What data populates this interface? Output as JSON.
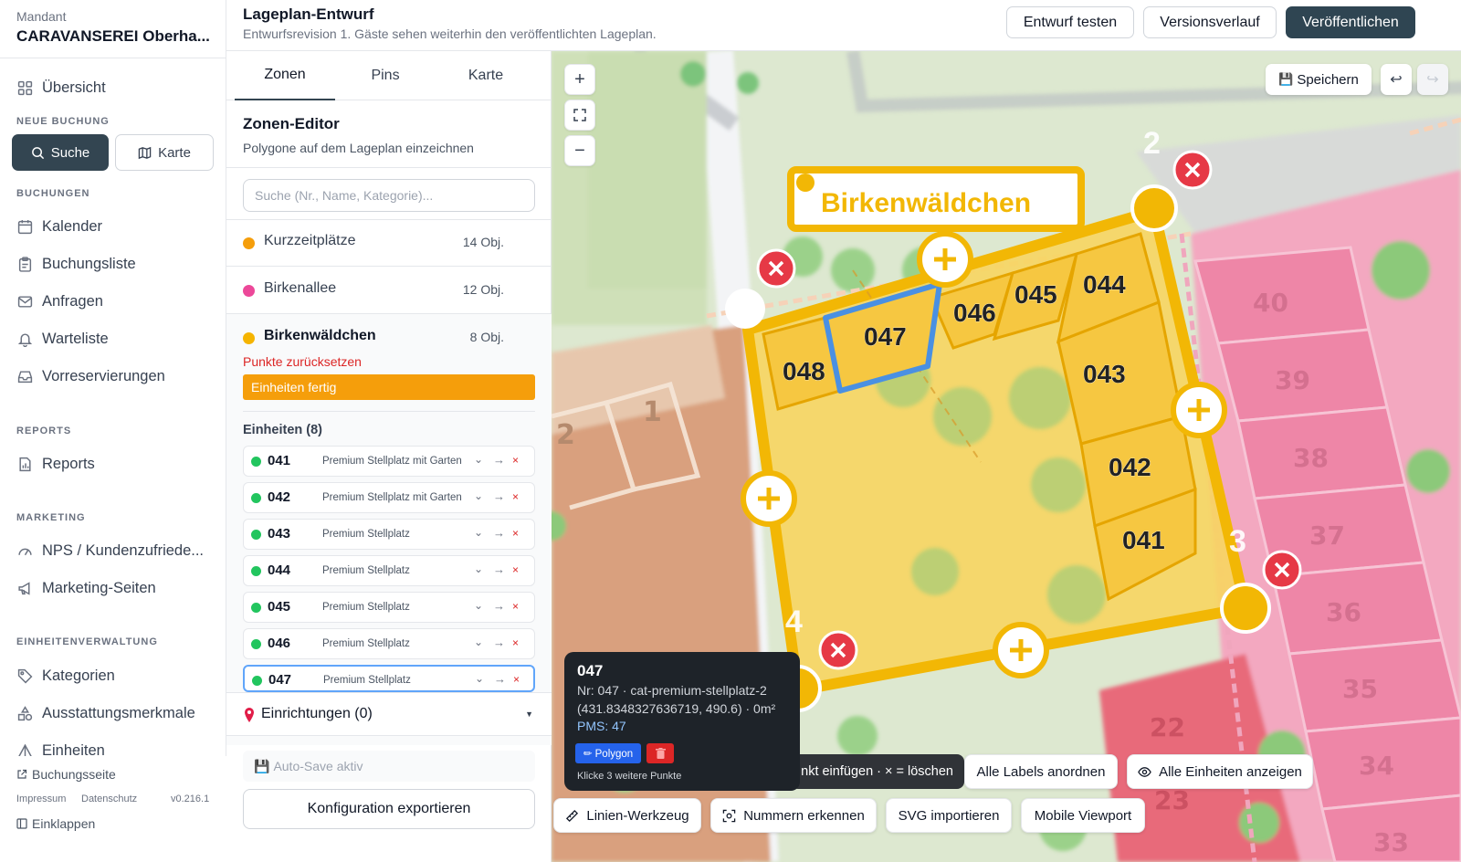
{
  "sidebar": {
    "tenant_label": "Mandant",
    "tenant_name": "CARAVANSEREI Oberha...",
    "overview": "Übersicht",
    "section_new_booking": "NEUE BUCHUNG",
    "btn_search": "Suche",
    "btn_map": "Karte",
    "section_bookings": "BUCHUNGEN",
    "calendar": "Kalender",
    "booking_list": "Buchungsliste",
    "inquiries": "Anfragen",
    "waitlist": "Warteliste",
    "prereservations": "Vorreservierungen",
    "section_reports": "REPORTS",
    "reports": "Reports",
    "section_marketing": "MARKETING",
    "nps": "NPS / Kundenzufriede...",
    "marketing_pages": "Marketing-Seiten",
    "section_units": "EINHEITENVERWALTUNG",
    "categories": "Kategorien",
    "features": "Ausstattungsmerkmale",
    "units": "Einheiten",
    "booking_page": "Buchungsseite",
    "imprint": "Impressum",
    "privacy": "Datenschutz",
    "version": "v0.216.1",
    "collapse": "Einklappen"
  },
  "header": {
    "title": "Lageplan-Entwurf",
    "subtitle": "Entwurfsrevision 1. Gäste sehen weiterhin den veröffentlichten Lageplan.",
    "btn_test": "Entwurf testen",
    "btn_history": "Versionsverlauf",
    "btn_publish": "Veröffentlichen"
  },
  "panel": {
    "tabs": [
      "Zonen",
      "Pins",
      "Karte"
    ],
    "title": "Zonen-Editor",
    "subtitle": "Polygone auf dem Lageplan einzeichnen",
    "search_placeholder": "Suche (Nr., Name, Kategorie)...",
    "zones": [
      {
        "name": "Kurzzeitplätze",
        "count": "14 Obj.",
        "color": "#f59e0b"
      },
      {
        "name": "Birkenallee",
        "count": "12 Obj.",
        "color": "#ec4899"
      },
      {
        "name": "Birkenwäldchen",
        "count": "8 Obj.",
        "color": "#f5b400"
      }
    ],
    "reset_points": "Punkte zurücksetzen",
    "units_done": "Einheiten fertig",
    "units_header": "Einheiten (8)",
    "units": [
      {
        "num": "041",
        "cat": "Premium Stellplatz mit Garten"
      },
      {
        "num": "042",
        "cat": "Premium Stellplatz mit Garten"
      },
      {
        "num": "043",
        "cat": "Premium Stellplatz"
      },
      {
        "num": "044",
        "cat": "Premium Stellplatz"
      },
      {
        "num": "045",
        "cat": "Premium Stellplatz"
      },
      {
        "num": "046",
        "cat": "Premium Stellplatz"
      },
      {
        "num": "047",
        "cat": "Premium Stellplatz"
      }
    ],
    "facilities": "Einrichtungen (0)",
    "autosave": "Auto-Save aktiv",
    "export": "Konfiguration exportieren"
  },
  "map": {
    "save": "Speichern",
    "zone_label": "Birkenwäldchen",
    "unit_labels": [
      "048",
      "047",
      "046",
      "045",
      "044",
      "043",
      "042",
      "041"
    ],
    "corner_numbers": [
      "2",
      "3",
      "4"
    ],
    "row_labels": [
      "40",
      "39",
      "38",
      "37",
      "36",
      "35",
      "34",
      "33",
      "22",
      "23",
      "1",
      "2"
    ],
    "tooltip": {
      "num": "047",
      "line1": "Nr: 047 · cat-premium-stellplatz-2",
      "line2": "(431.8348327636719, 490.6) · 0m²",
      "pms": "PMS: 47",
      "polygon": "✏ Polygon",
      "hint": "Klicke 3 weitere Punkte"
    },
    "hint": "nkt einfügen · × = löschen",
    "btn_arrange": "Alle Labels anordnen",
    "btn_show_all": "Alle Einheiten anzeigen",
    "btn_line": "Linien-Werkzeug",
    "btn_detect": "Nummern erkennen",
    "btn_svg": "SVG importieren",
    "btn_mobile": "Mobile Viewport"
  },
  "colors": {
    "primary": "#2f4552",
    "zone_yellow": "#f5b400",
    "accent_orange": "#f59e0b",
    "delete_red": "#e63946",
    "selection_blue": "#4a90e2",
    "pink_zone": "#f48fb1"
  }
}
